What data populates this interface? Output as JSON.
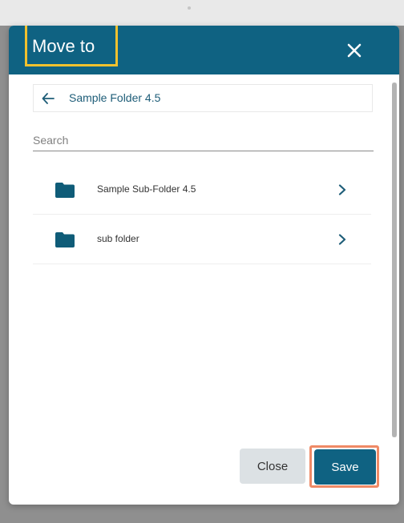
{
  "dialog": {
    "title": "Move to",
    "close_icon": "close-icon"
  },
  "breadcrumb": {
    "back_icon": "arrow-left-icon",
    "label": "Sample Folder 4.5"
  },
  "search": {
    "placeholder": "Search",
    "value": ""
  },
  "folders": [
    {
      "name": "Sample Sub-Folder 4.5",
      "icon": "folder-icon",
      "chevron": "chevron-right-icon"
    },
    {
      "name": "sub folder",
      "icon": "folder-icon",
      "chevron": "chevron-right-icon"
    }
  ],
  "footer": {
    "close_label": "Close",
    "save_label": "Save"
  },
  "colors": {
    "header": "#0f6282",
    "primary_button": "#0f6282",
    "title_highlight": "#f2c12e",
    "save_highlight": "#ef8a66",
    "secondary_button": "#dce1e4"
  }
}
